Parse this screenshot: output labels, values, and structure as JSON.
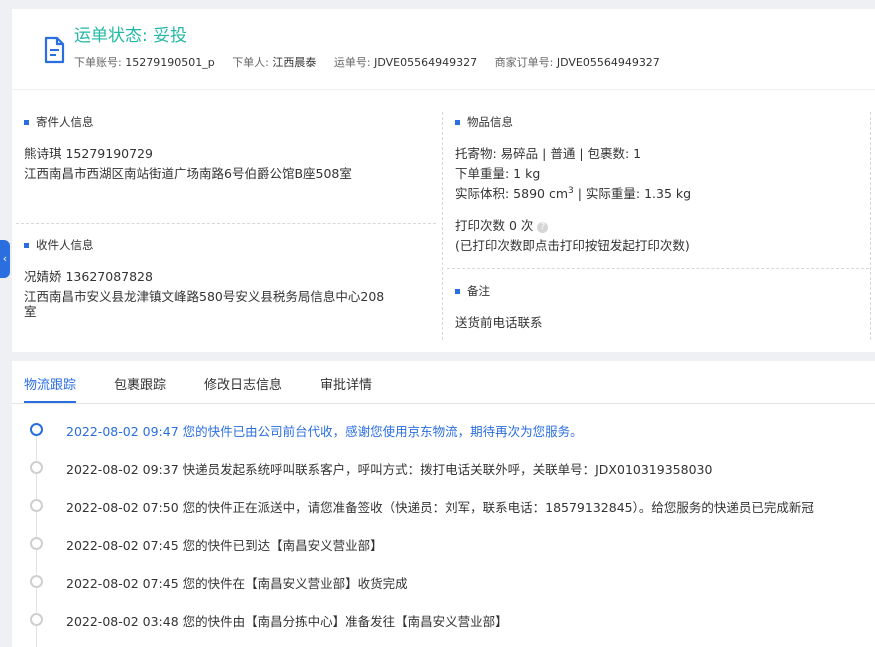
{
  "header": {
    "status_title": "运单状态: 妥投",
    "meta": [
      {
        "label": "下单账号:",
        "value": "15279190501_p"
      },
      {
        "label": "下单人:",
        "value": "江西晨泰"
      },
      {
        "label": "运单号:",
        "value": "JDVE05564949327"
      },
      {
        "label": "商家订单号:",
        "value": "JDVE05564949327"
      }
    ]
  },
  "sender": {
    "section_title": "寄件人信息",
    "name_phone": "熊诗琪   15279190729",
    "address": "江西南昌市西湖区南站街道广场南路6号伯爵公馆B座508室"
  },
  "receiver": {
    "section_title": "收件人信息",
    "name_phone": "况婧娇   13627087828",
    "address_line1": "江西南昌市安义县龙津镇文峰路580号安义县税务局信息中心208",
    "address_line2": "室"
  },
  "goods": {
    "section_title": "物品信息",
    "line1": "托寄物:  易碎品 | 普通  |  包裹数:  1",
    "line2": "下单重量:   1 kg",
    "volume_prefix": "实际体积:    5890 cm",
    "volume_sup": "3",
    "volume_suffix": " |  实际重量:   1.35 kg",
    "print_count": "打印次数    0 次",
    "help_glyph": "?",
    "print_hint": "(已打印次数即点击打印按钮发起打印次数)"
  },
  "remark": {
    "section_title": "备注",
    "text": "送货前电话联系"
  },
  "side_tab": {
    "glyph": "‹"
  },
  "tabs": [
    {
      "label": "物流跟踪",
      "active": true
    },
    {
      "label": "包裹跟踪",
      "active": false
    },
    {
      "label": "修改日志信息",
      "active": false
    },
    {
      "label": "审批详情",
      "active": false
    }
  ],
  "tracking": [
    {
      "text": "2022-08-02 09:47 您的快件已由公司前台代收，感谢您使用京东物流，期待再次为您服务。",
      "active": true
    },
    {
      "text": "2022-08-02 09:37 快递员发起系统呼叫联系客户，呼叫方式：拨打电话关联外呼，关联单号：JDX010319358030",
      "active": false
    },
    {
      "text": "2022-08-02 07:50 您的快件正在派送中，请您准备签收（快递员：刘军，联系电话：18579132845）。给您服务的快递员已完成新冠",
      "active": false
    },
    {
      "text": "2022-08-02 07:45 您的快件已到达【南昌安义营业部】",
      "active": false
    },
    {
      "text": "2022-08-02 07:45 您的快件在【南昌安义营业部】收货完成",
      "active": false
    },
    {
      "text": "2022-08-02 03:48 您的快件由【南昌分拣中心】准备发往【南昌安义营业部】",
      "active": false
    }
  ],
  "colors": {
    "accent": "#2a6ee0",
    "status": "#23b8a6"
  }
}
